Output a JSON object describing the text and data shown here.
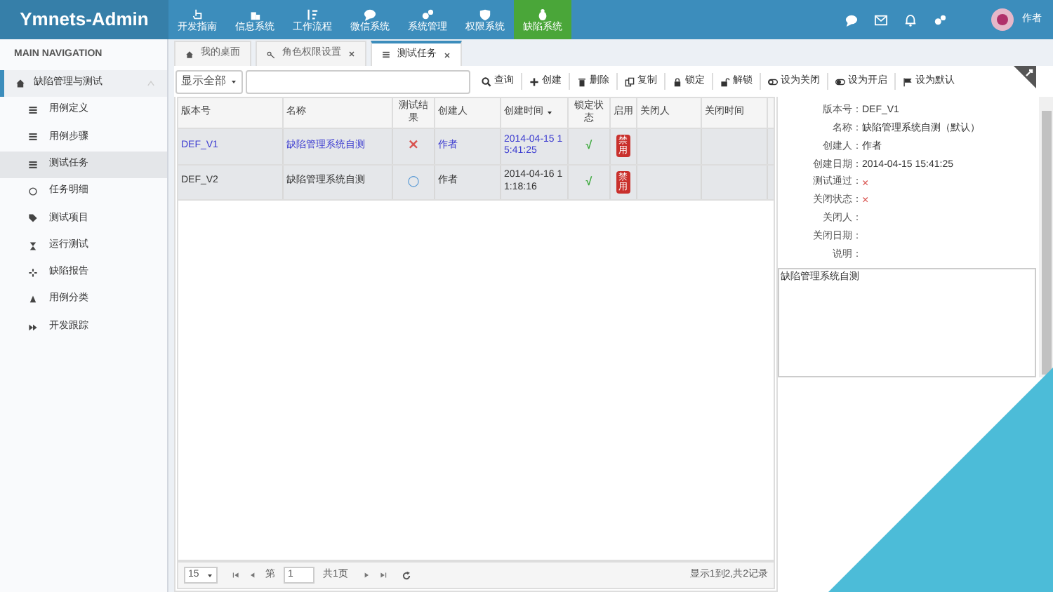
{
  "app": {
    "logo": "Ymnets-Admin",
    "user": "作者"
  },
  "top_nav": [
    {
      "label": "开发指南",
      "selected": false
    },
    {
      "label": "信息系统",
      "selected": false
    },
    {
      "label": "工作流程",
      "selected": false
    },
    {
      "label": "微信系统",
      "selected": false
    },
    {
      "label": "系统管理",
      "selected": false
    },
    {
      "label": "权限系统",
      "selected": false
    },
    {
      "label": "缺陷系统",
      "selected": true
    }
  ],
  "sidebar": {
    "header": "MAIN NAVIGATION",
    "items": [
      {
        "label": "缺陷管理与测试",
        "expanded": true,
        "children": [
          {
            "label": "用例定义",
            "selected": false
          },
          {
            "label": "用例步骤",
            "selected": false
          },
          {
            "label": "测试任务",
            "selected": true
          },
          {
            "label": "任务明细",
            "selected": false
          },
          {
            "label": "测试项目",
            "selected": false
          },
          {
            "label": "运行测试",
            "selected": false
          },
          {
            "label": "缺陷报告",
            "selected": false
          },
          {
            "label": "用例分类",
            "selected": false
          },
          {
            "label": "开发跟踪",
            "selected": false
          }
        ]
      }
    ]
  },
  "tabs": [
    {
      "label": "我的桌面",
      "selected": false,
      "closable": false
    },
    {
      "label": "角色权限设置",
      "selected": false,
      "closable": true
    },
    {
      "label": "测试任务",
      "selected": true,
      "closable": true
    }
  ],
  "filter": {
    "value": "显示全部"
  },
  "toolbar": [
    "查询",
    "创建",
    "删除",
    "复制",
    "锁定",
    "解锁",
    "设为关闭",
    "设为开启",
    "设为默认"
  ],
  "table": {
    "columns": [
      "版本号",
      "名称",
      "测试结果",
      "创建人",
      "创建时间",
      "锁定状态",
      "启用",
      "关闭人",
      "关闭时间"
    ],
    "rows": [
      {
        "selected": true,
        "version": "DEF_V1",
        "name": "缺陷管理系统自测",
        "result": "×",
        "color": "#d9534f",
        "creator": "作者",
        "created": "2014-04-15 15:41:25",
        "locked": "√",
        "enable": "禁用"
      },
      {
        "selected": false,
        "version": "DEF_V2",
        "name": "缺陷管理系统自测",
        "result": "○",
        "color": "#5b9bd5",
        "creator": "作者",
        "created": "2014-04-16 11:18:16",
        "locked": "√",
        "enable": "禁用"
      }
    ]
  },
  "pager": {
    "page_size": "15",
    "page_prefix": "第",
    "page": "1",
    "page_total": "共1页",
    "summary": "显示1到2,共2记录"
  },
  "detail": {
    "fields": [
      {
        "label": "版本号：",
        "value": "DEF_V1",
        "kind": "text"
      },
      {
        "label": "名称：",
        "value": "缺陷管理系统自测（默认）",
        "kind": "text"
      },
      {
        "label": "创建人：",
        "value": "作者",
        "kind": "text"
      },
      {
        "label": "创建日期：",
        "value": "2014-04-15 15:41:25",
        "kind": "text"
      },
      {
        "label": "测试通过：",
        "value": "×",
        "kind": "mark"
      },
      {
        "label": "关闭状态：",
        "value": "×",
        "kind": "mark"
      },
      {
        "label": "关闭人："
      },
      {
        "label": "关闭日期："
      },
      {
        "label": "说明："
      }
    ],
    "note": "缺陷管理系统自测"
  }
}
